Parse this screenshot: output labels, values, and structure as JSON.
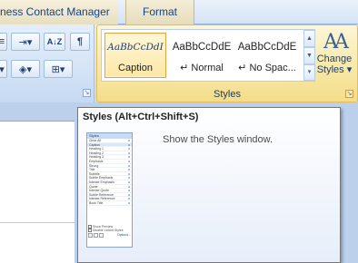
{
  "tabs": {
    "contextual_label": "ness Contact Manager",
    "format_label": "Format"
  },
  "paragraph_group": {
    "launcher_icon": "dialog-launcher-icon"
  },
  "styles_group": {
    "label": "Styles",
    "gallery": [
      {
        "sample": "AaBbCcDdI",
        "name": "Caption",
        "selected": true
      },
      {
        "sample": "AaBbCcDdE",
        "name": "↵ Normal",
        "selected": false
      },
      {
        "sample": "AaBbCcDdE",
        "name": "↵ No Spac...",
        "selected": false
      }
    ],
    "change_styles_label": "Change Styles ▾",
    "accent_color": "#f4dd8a"
  },
  "tooltip": {
    "title": "Styles (Alt+Ctrl+Shift+S)",
    "description": "Show the Styles window.",
    "thumbnail": {
      "header": "Styles",
      "rows": [
        "Clear All",
        "Caption",
        "Heading 1",
        "Heading 2",
        "Heading 3",
        "Emphasis",
        "Strong",
        "Title",
        "Subtitle",
        "Subtle Emphasis",
        "Intense Emphasis",
        "Quote",
        "Intense Quote",
        "Subtle Reference",
        "Intense Reference",
        "Book Title"
      ],
      "checkbox_1": "Show Preview",
      "checkbox_2": "Disable Linked Styles",
      "options_link": "Options..."
    }
  }
}
